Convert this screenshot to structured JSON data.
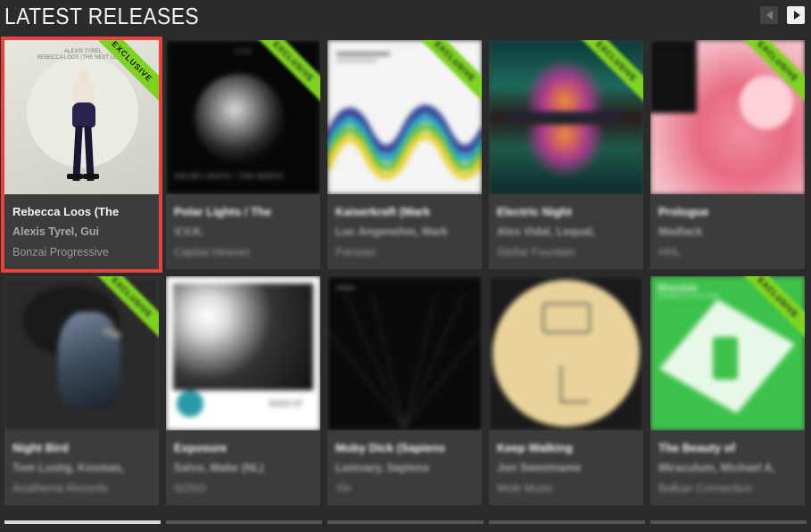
{
  "section": {
    "title": "LATEST RELEASES"
  },
  "nav": {
    "prev_icon": "chevron-left-icon",
    "next_icon": "chevron-right-icon"
  },
  "colors": {
    "accent": "#e8423f",
    "ribbon": "#7ed321",
    "background": "#2b2b2b",
    "card": "#3c3c3c"
  },
  "releases": [
    {
      "title": "Rebecca Loos (The",
      "artists": "Alexis Tyrel, Gui",
      "label": "Bonzai Progressive",
      "ribbon": "EXCLUSIVE",
      "art_text": {
        "artist": "ALEXIS TYREL",
        "title": "REBECCA LOOS (THE NEXT LEVEL)"
      }
    },
    {
      "title": "Polar Lights / The",
      "artists": "V.V.K.",
      "label": "Capital Heaven",
      "ribbon": "EXCLUSIVE",
      "art_text": {
        "top": "V V K",
        "bottom": "POLAR LIGHTS / THE NORTH"
      }
    },
    {
      "title": "Kaiserkraft (Mark",
      "artists": "Luc Angenehm, Mark",
      "label": "Parisian",
      "ribbon": "EXCLUSIVE"
    },
    {
      "title": "Electric Night",
      "artists": "Alex Vidal, Lequal,",
      "label": "Stellar Fountain",
      "ribbon": "EXCLUSIVE"
    },
    {
      "title": "Prologue",
      "artists": "Madlack",
      "label": "HHL",
      "ribbon": "EXCLUSIVE"
    },
    {
      "title": "Night Bird",
      "artists": "Tom Lustig, Kosmas,",
      "label": "Anathema Records",
      "ribbon": "EXCLUSIVE"
    },
    {
      "title": "Exposure",
      "artists": "Salvo, Mabe (NL)",
      "label": "SOSO",
      "ribbon": "",
      "art_text": {
        "code": "SOSO 57"
      }
    },
    {
      "title": "Moby Dick (Sapiens",
      "artists": "Lamvary, Sapiens",
      "label": "Yin",
      "ribbon": ""
    },
    {
      "title": "Keep Walking",
      "artists": "Jon Sweetname",
      "label": "Mole Music",
      "ribbon": ""
    },
    {
      "title": "The Beauty of",
      "artists": "Miraculum, Michael A,",
      "label": "Balkan Connection",
      "ribbon": "EXCLUSIVE",
      "art_text": {
        "brand": "Miraculum",
        "sub": "THE BEAUTY OF THE STARS"
      }
    }
  ]
}
